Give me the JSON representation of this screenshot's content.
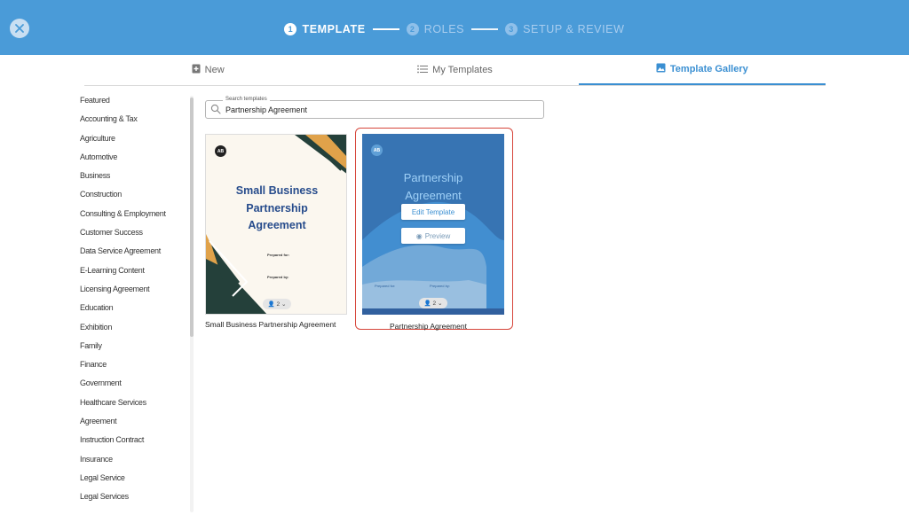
{
  "header": {
    "steps": [
      {
        "num": "1",
        "label": "TEMPLATE"
      },
      {
        "num": "2",
        "label": "ROLES"
      },
      {
        "num": "3",
        "label": "SETUP & REVIEW"
      }
    ],
    "active_step": 1,
    "bar_color": "#4a9bd8"
  },
  "tabs": [
    {
      "label": "New",
      "icon": "new-document-icon"
    },
    {
      "label": "My Templates",
      "icon": "list-icon"
    },
    {
      "label": "Template Gallery",
      "icon": "gallery-icon"
    }
  ],
  "active_tab": "Template Gallery",
  "accent_color": "#3a8fd2",
  "categories": [
    "Featured",
    "Accounting & Tax",
    "Agriculture",
    "Automotive",
    "Business",
    "Construction",
    "Consulting & Employment",
    "Customer Success",
    "Data Service Agreement",
    "E-Learning Content",
    "Licensing Agreement",
    "Education",
    "Exhibition",
    "Family",
    "Finance",
    "Government",
    "Healthcare Services",
    "Agreement",
    "Instruction Contract",
    "Insurance",
    "Legal Service",
    "Legal Services"
  ],
  "search": {
    "label": "Search templates",
    "value": "Partnership Agreement"
  },
  "templates": [
    {
      "name": "Small Business Partnership Agreement",
      "cover_title": [
        "Small Business",
        "Partnership",
        "Agreement"
      ],
      "prepared_for": "Prepared for:",
      "prepared_by": "Prepared by:",
      "roles": "2",
      "logo": "AB"
    },
    {
      "name": "Partnership Agreement",
      "cover_title": [
        "Partnership",
        "Agreement"
      ],
      "prepared_for": "Prepared for:",
      "prepared_by": "Prepared by:",
      "roles": "2",
      "logo": "AB",
      "edit_label": "Edit Template",
      "preview_label": "Preview",
      "highlight_color": "#d6453a"
    }
  ]
}
